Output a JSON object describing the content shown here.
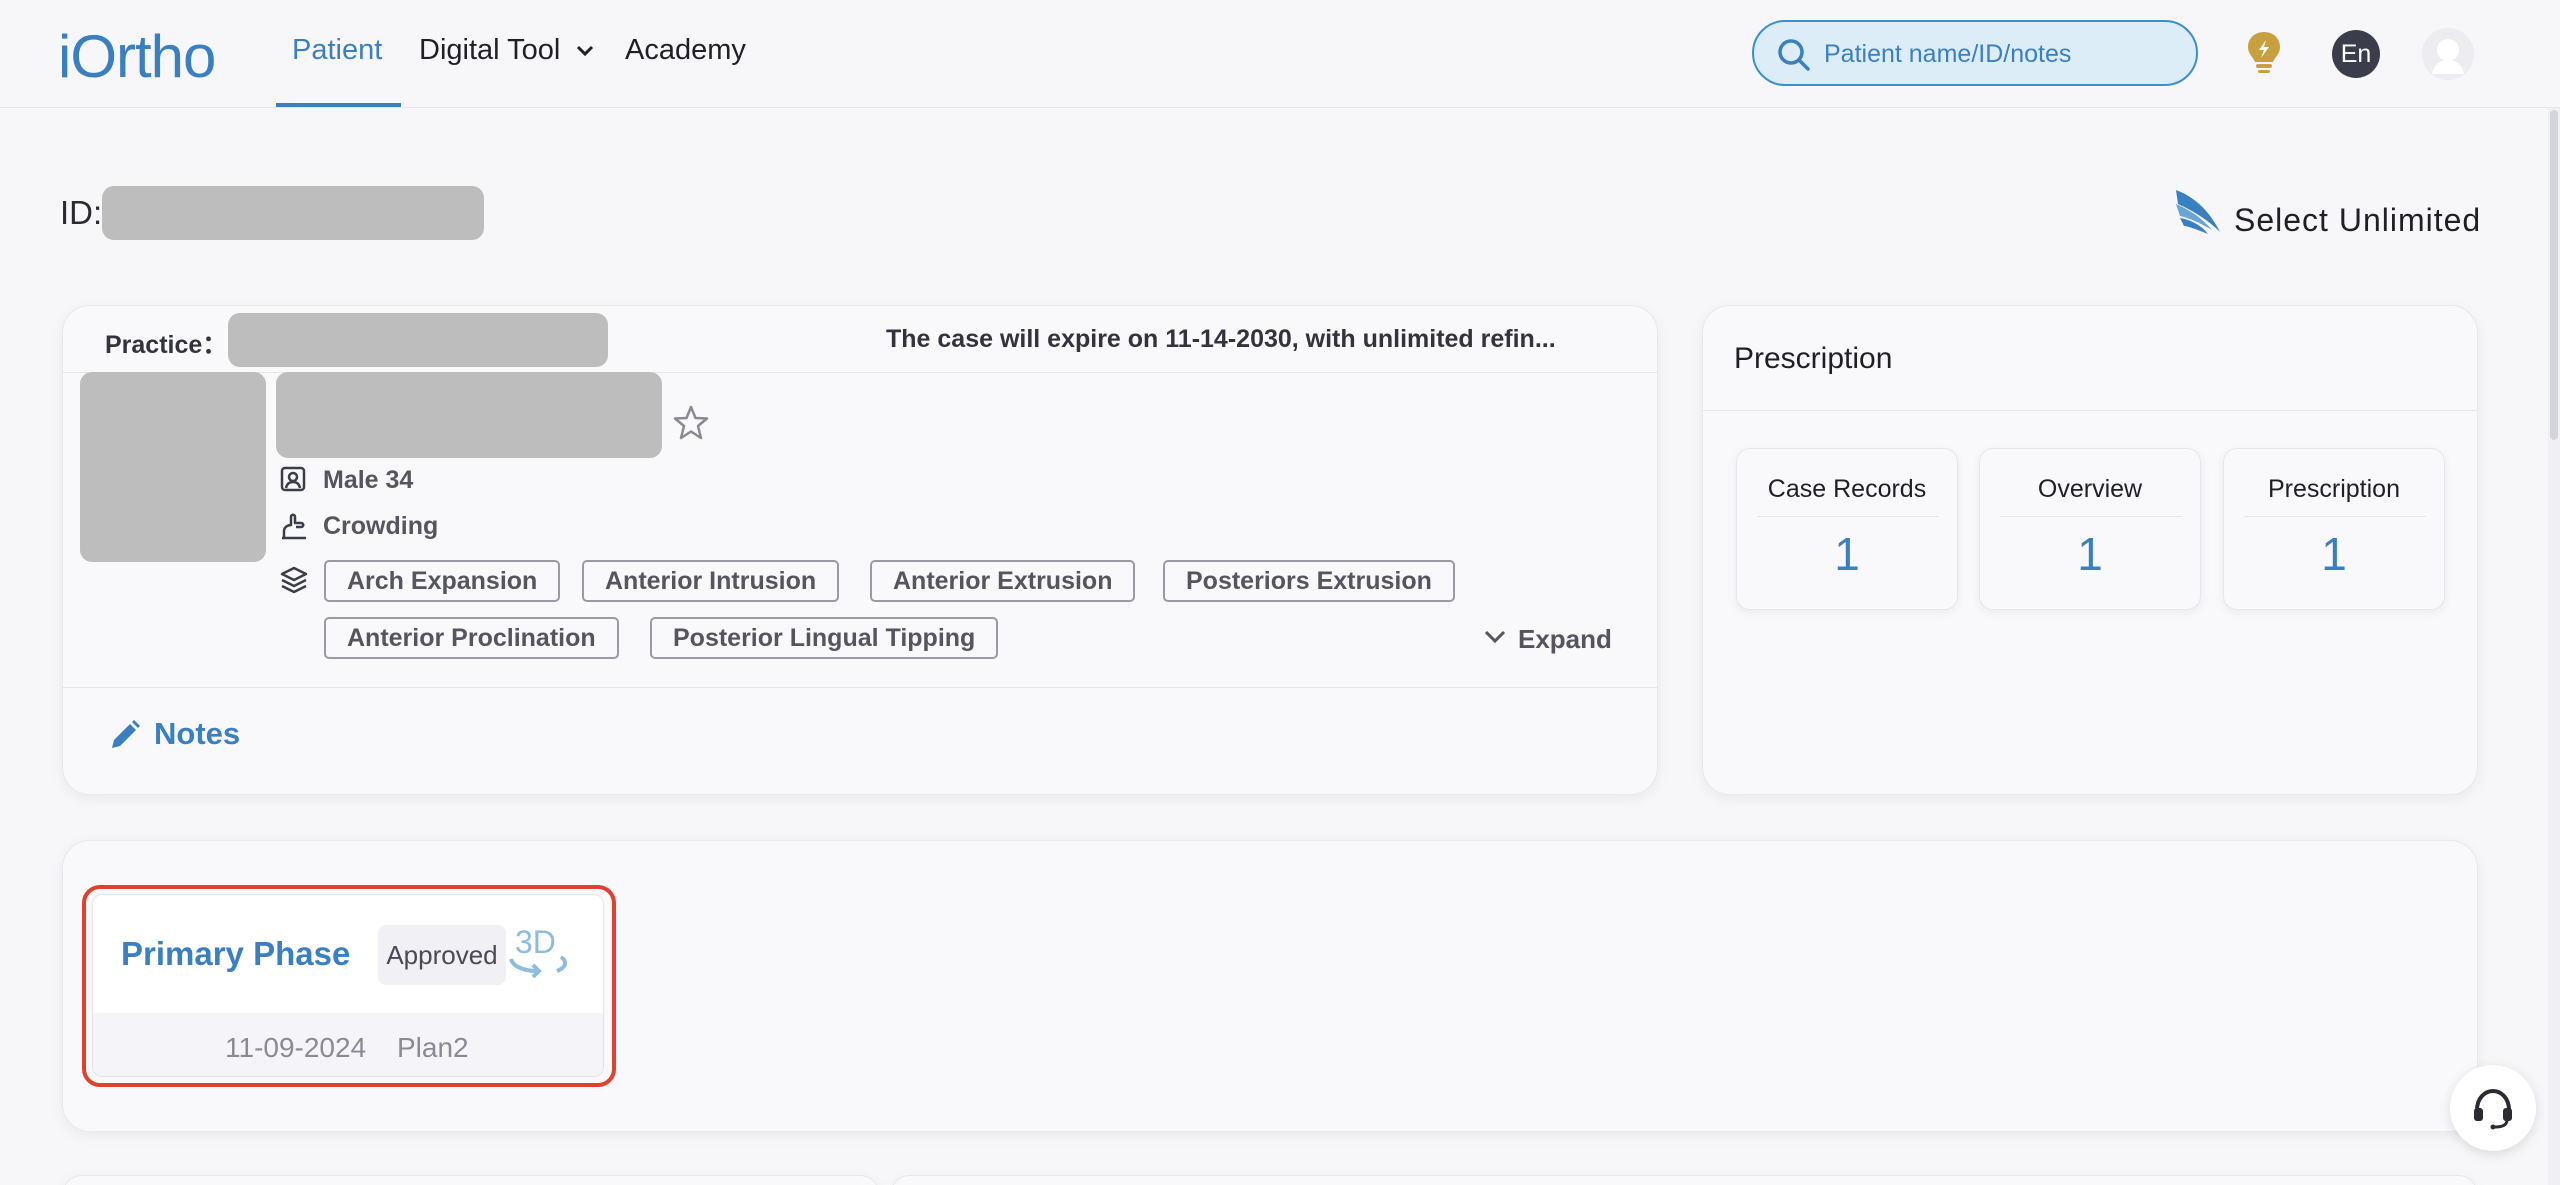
{
  "header": {
    "logo": "iOrtho",
    "nav": [
      {
        "label": "Patient",
        "active": true
      },
      {
        "label": "Digital Tool",
        "active": false
      },
      {
        "label": "Academy",
        "active": false
      }
    ],
    "search_placeholder": "Patient name/ID/notes",
    "language": "En"
  },
  "patient": {
    "id_label": "ID:",
    "brand": "Select Unlimited",
    "practice_label": "Practice：",
    "expire_text": "The case will expire on 11-14-2030, with unlimited refin...",
    "gender_age": "Male 34",
    "condition": "Crowding",
    "treatments": [
      "Arch Expansion",
      "Anterior Intrusion",
      "Anterior Extrusion",
      "Posteriors Extrusion",
      "Anterior Proclination",
      "Posterior Lingual Tipping"
    ],
    "expand_label": "Expand",
    "notes_label": "Notes"
  },
  "prescription": {
    "title": "Prescription",
    "stats": [
      {
        "label": "Case Records",
        "value": "1"
      },
      {
        "label": "Overview",
        "value": "1"
      },
      {
        "label": "Prescription",
        "value": "1"
      }
    ]
  },
  "phase": {
    "title": "Primary Phase",
    "status": "Approved",
    "icon_text": "3D",
    "date": "11-09-2024",
    "plan": "Plan2"
  },
  "colors": {
    "accent": "#3a7fc0",
    "highlight": "#e0402f",
    "redacted": "#bdbdbd"
  }
}
